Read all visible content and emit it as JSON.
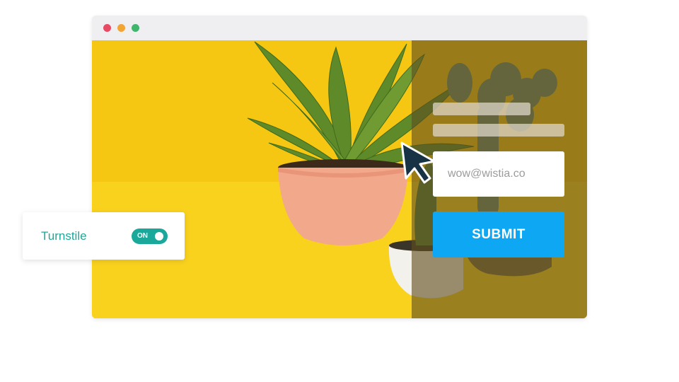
{
  "window": {
    "controls": [
      "close-dot",
      "minimize-dot",
      "maximize-dot"
    ],
    "colors": {
      "close": "#e84a64",
      "minimize": "#f2a531",
      "maximize": "#3fb66b"
    }
  },
  "video": {
    "background_color": "#f6c712",
    "overlay_color": "#5f4e1e"
  },
  "form": {
    "email_value": "wow@wistia.co",
    "submit_label": "SUBMIT",
    "submit_color": "#0ea7f4"
  },
  "turnstile": {
    "label": "Turnstile",
    "toggle_text": "ON",
    "toggle_state": "on",
    "accent_color": "#1aa89a"
  },
  "icons": [
    "pointer-cursor-icon"
  ]
}
